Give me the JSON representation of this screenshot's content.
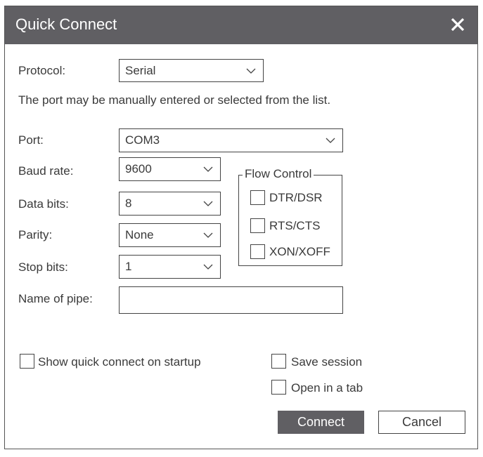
{
  "dialog": {
    "title": "Quick Connect",
    "close_icon": "close-icon"
  },
  "protocol": {
    "label": "Protocol:",
    "value": "Serial"
  },
  "help_text": "The port may be manually entered or selected from the list.",
  "port": {
    "label": "Port:",
    "value": "COM3"
  },
  "baud_rate": {
    "label": "Baud rate:",
    "value": "9600"
  },
  "data_bits": {
    "label": "Data bits:",
    "value": "8"
  },
  "parity": {
    "label": "Parity:",
    "value": "None"
  },
  "stop_bits": {
    "label": "Stop bits:",
    "value": "1"
  },
  "pipe": {
    "label": "Name of pipe:",
    "value": ""
  },
  "flow_control": {
    "legend": "Flow Control",
    "options": [
      {
        "label": "DTR/DSR",
        "checked": false
      },
      {
        "label": "RTS/CTS",
        "checked": false
      },
      {
        "label": "XON/XOFF",
        "checked": false
      }
    ]
  },
  "options": {
    "show_on_startup": "Show quick connect on startup",
    "save_session": "Save session",
    "open_in_tab": "Open in a tab"
  },
  "buttons": {
    "connect": "Connect",
    "cancel": "Cancel"
  }
}
